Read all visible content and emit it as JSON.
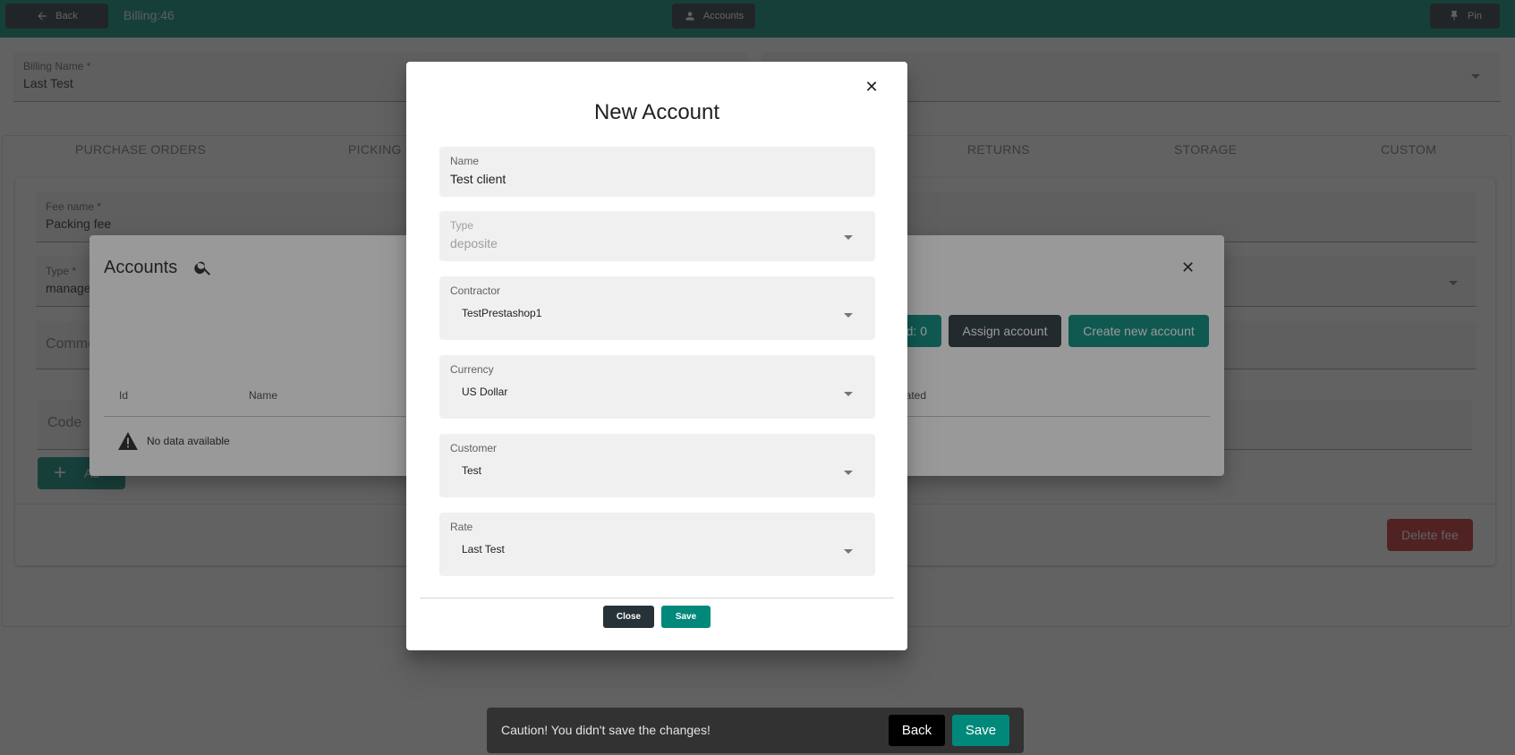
{
  "topbar": {
    "back_label": "Back",
    "title": "Billing:46",
    "accounts_label": "Accounts",
    "pin_label": "Pin"
  },
  "billing": {
    "name_label": "Billing Name *",
    "name_value": "Last Test"
  },
  "tabs": [
    "PURCHASE ORDERS",
    "PICKING",
    "RETURNS",
    "STORAGE",
    "CUSTOM"
  ],
  "fee": {
    "name_label": "Fee name *",
    "name_value": "Packing fee",
    "type_label": "Type *",
    "type_value": "manage",
    "comment_placeholder": "Comme",
    "code_placeholder": "Code",
    "add_label": "Ad",
    "delete_label": "Delete fee"
  },
  "accounts_dialog": {
    "title": "Accounts",
    "selected_label": "d: 0",
    "assign_label": "Assign account",
    "create_label": "Create new account",
    "headers": [
      "Id",
      "Name",
      "eated"
    ],
    "no_data": "No data available"
  },
  "new_account": {
    "title": "New Account",
    "fields": {
      "name": {
        "label": "Name",
        "value": "Test client"
      },
      "type": {
        "label": "Type",
        "value": "deposite"
      },
      "contractor": {
        "label": "Contractor",
        "value": "TestPrestashop1"
      },
      "currency": {
        "label": "Currency",
        "value": "US Dollar"
      },
      "customer": {
        "label": "Customer",
        "value": "Test"
      },
      "rate": {
        "label": "Rate",
        "value": "Last Test"
      }
    },
    "close_label": "Close",
    "save_label": "Save"
  },
  "snackbar": {
    "message": "Caution! You didn't save the changes!",
    "back_label": "Back",
    "save_label": "Save"
  },
  "colors": {
    "primary": "#00897b",
    "dark": "#263238",
    "danger": "#c62828"
  }
}
